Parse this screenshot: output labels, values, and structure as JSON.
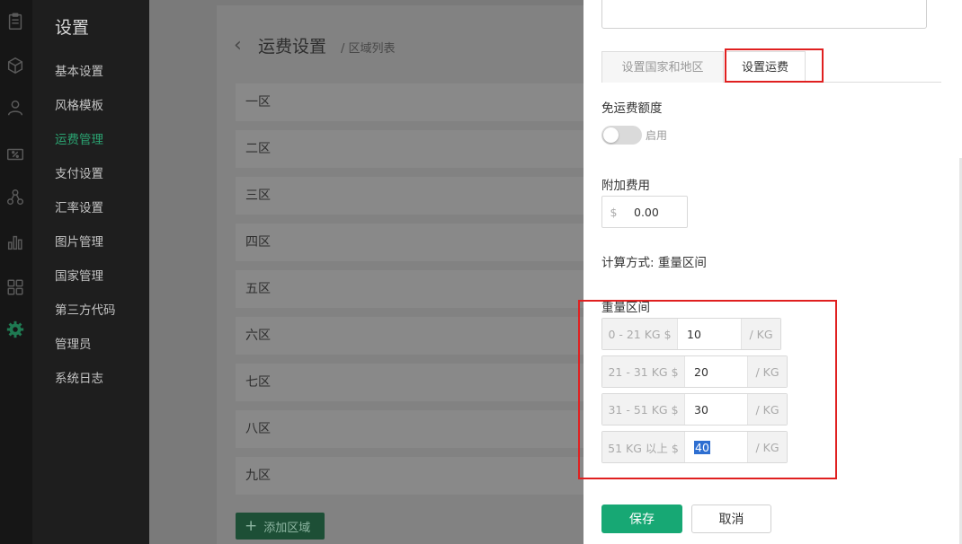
{
  "sidebar": {
    "title": "设置",
    "items": [
      {
        "label": "基本设置"
      },
      {
        "label": "风格模板"
      },
      {
        "label": "运费管理",
        "active": true
      },
      {
        "label": "支付设置"
      },
      {
        "label": "汇率设置"
      },
      {
        "label": "图片管理"
      },
      {
        "label": "国家管理"
      },
      {
        "label": "第三方代码"
      },
      {
        "label": "管理员"
      },
      {
        "label": "系统日志"
      }
    ]
  },
  "rail_icons": [
    "clipboard-icon",
    "box-icon",
    "user-icon",
    "discount-icon",
    "network-icon",
    "bar-chart-icon",
    "apps-icon",
    "gear-icon"
  ],
  "main": {
    "page_title": "运费设置",
    "breadcrumb": "/ 区域列表",
    "zones": [
      "一区",
      "二区",
      "三区",
      "四区",
      "五区",
      "六区",
      "七区",
      "八区",
      "九区"
    ],
    "add_button": "添加区域"
  },
  "panel": {
    "tabs": [
      {
        "label": "设置国家和地区",
        "active": false
      },
      {
        "label": "设置运费",
        "active": true
      }
    ],
    "free_shipping": {
      "label": "免运费额度",
      "toggle_label": "启用",
      "enabled": false
    },
    "extra_fee": {
      "label": "附加费用",
      "currency": "$",
      "value": "0.00"
    },
    "calc_method": "计算方式: 重量区间",
    "weight_ranges": {
      "label": "重量区间",
      "rows": [
        {
          "prefix": "0 - 21 KG $",
          "value": "10",
          "suffix": "/ KG"
        },
        {
          "prefix": "21 - 31 KG $",
          "value": "20",
          "suffix": "/ KG"
        },
        {
          "prefix": "31 - 51 KG $",
          "value": "30",
          "suffix": "/ KG"
        },
        {
          "prefix": "51 KG 以上 $",
          "value": "40",
          "suffix": "/ KG"
        }
      ]
    },
    "save_button": "保存",
    "cancel_button": "取消"
  },
  "colors": {
    "accent": "#17a874",
    "highlight": "#e02020",
    "sidebar_active": "#2ba371"
  }
}
